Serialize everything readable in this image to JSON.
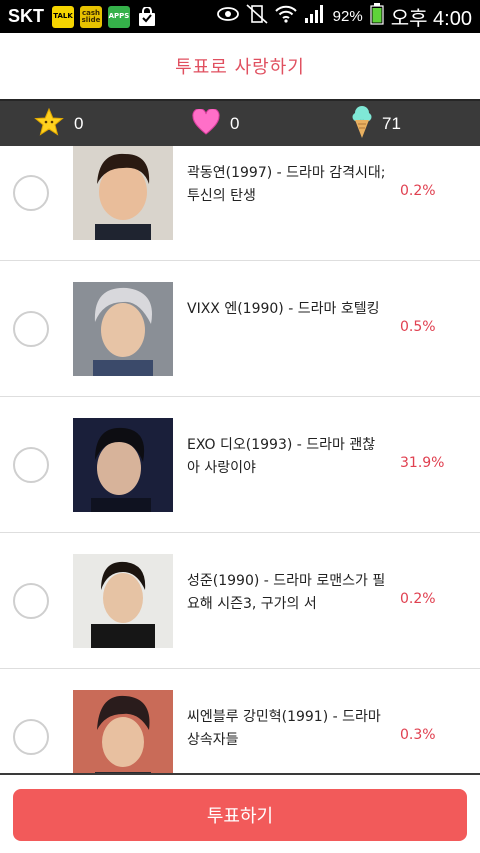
{
  "status_bar": {
    "carrier": "SKT",
    "apps": [
      "TALK",
      "cash slide",
      "APPS"
    ],
    "battery": "92%",
    "time": "오후 4:00"
  },
  "header": {
    "title": "투표로 사랑하기"
  },
  "counters": {
    "star": "0",
    "heart": "0",
    "ice_cream": "71"
  },
  "list": {
    "items": [
      {
        "text": "곽동연(1997) - 드라마 감격시대;투신의 탄생",
        "percent": "0.2%"
      },
      {
        "text": "VIXX 엔(1990) - 드라마 호텔킹",
        "percent": "0.5%"
      },
      {
        "text": "EXO 디오(1993) - 드라마 괜찮아 사랑이야",
        "percent": "31.9%"
      },
      {
        "text": "성준(1990) - 드라마 로맨스가 필요해 시즌3, 구가의 서",
        "percent": "0.2%"
      },
      {
        "text": "씨엔블루 강민혁(1991) - 드라마 상속자들",
        "percent": "0.3%"
      }
    ]
  },
  "footer": {
    "vote_label": "투표하기"
  },
  "colors": {
    "accent": "#f25a5a",
    "percent": "#e04050",
    "counter_bar": "#3a3a3a"
  }
}
